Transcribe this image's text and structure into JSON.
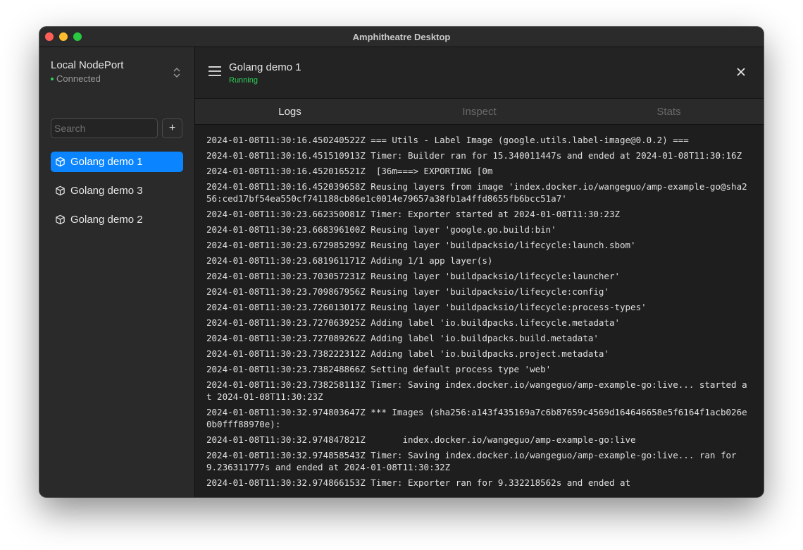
{
  "window": {
    "title": "Amphitheatre Desktop"
  },
  "sidebar": {
    "context_name": "Local NodePort",
    "context_status": "Connected",
    "search_placeholder": "Search",
    "add_label": "+",
    "items": [
      {
        "label": "Golang demo 1",
        "active": true
      },
      {
        "label": "Golang demo 3",
        "active": false
      },
      {
        "label": "Golang demo 2",
        "active": false
      }
    ]
  },
  "header": {
    "app_name": "Golang demo 1",
    "app_status": "Running"
  },
  "tabs": [
    {
      "label": "Logs",
      "active": true
    },
    {
      "label": "Inspect",
      "active": false
    },
    {
      "label": "Stats",
      "active": false
    }
  ],
  "logs": [
    "2024-01-08T11:30:16.450240522Z === Utils - Label Image (google.utils.label-image@0.0.2) ===",
    "2024-01-08T11:30:16.451510913Z Timer: Builder ran for 15.340011447s and ended at 2024-01-08T11:30:16Z",
    "2024-01-08T11:30:16.452016521Z  [36m===> EXPORTING [0m",
    "2024-01-08T11:30:16.452039658Z Reusing layers from image 'index.docker.io/wangeguo/amp-example-go@sha256:ced17bf54ea550cf741188cb86e1c0014e79657a38fb1a4ffd8655fb6bcc51a7'",
    "2024-01-08T11:30:23.662350081Z Timer: Exporter started at 2024-01-08T11:30:23Z",
    "2024-01-08T11:30:23.668396100Z Reusing layer 'google.go.build:bin'",
    "2024-01-08T11:30:23.672985299Z Reusing layer 'buildpacksio/lifecycle:launch.sbom'",
    "2024-01-08T11:30:23.681961171Z Adding 1/1 app layer(s)",
    "2024-01-08T11:30:23.703057231Z Reusing layer 'buildpacksio/lifecycle:launcher'",
    "2024-01-08T11:30:23.709867956Z Reusing layer 'buildpacksio/lifecycle:config'",
    "2024-01-08T11:30:23.726013017Z Reusing layer 'buildpacksio/lifecycle:process-types'",
    "2024-01-08T11:30:23.727063925Z Adding label 'io.buildpacks.lifecycle.metadata'",
    "2024-01-08T11:30:23.727089262Z Adding label 'io.buildpacks.build.metadata'",
    "2024-01-08T11:30:23.738222312Z Adding label 'io.buildpacks.project.metadata'",
    "2024-01-08T11:30:23.738248866Z Setting default process type 'web'",
    "2024-01-08T11:30:23.738258113Z Timer: Saving index.docker.io/wangeguo/amp-example-go:live... started at 2024-01-08T11:30:23Z",
    "2024-01-08T11:30:32.974803647Z *** Images (sha256:a143f435169a7c6b87659c4569d164646658e5f6164f1acb026e0b0fff88970e):",
    "2024-01-08T11:30:32.974847821Z       index.docker.io/wangeguo/amp-example-go:live",
    "2024-01-08T11:30:32.974858543Z Timer: Saving index.docker.io/wangeguo/amp-example-go:live... ran for 9.236311777s and ended at 2024-01-08T11:30:32Z",
    "2024-01-08T11:30:32.974866153Z Timer: Exporter ran for 9.332218562s and ended at"
  ]
}
